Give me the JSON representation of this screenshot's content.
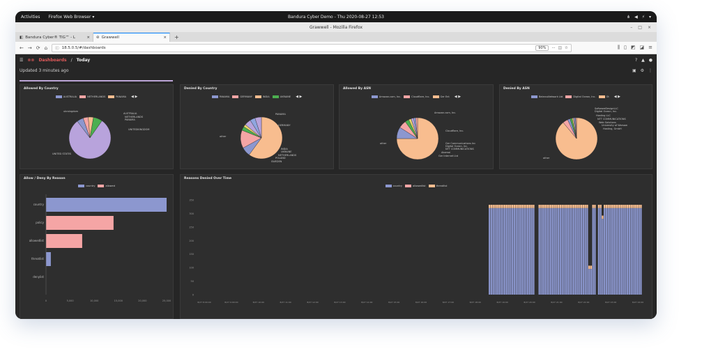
{
  "os_bar": {
    "activities": "Activities",
    "app_menu": "Firefox Web Browser ▾",
    "clock": "Bandura Cyber Demo - Thu 2020-08-27 12:53",
    "tray": [
      "⋔",
      "◀",
      "⚡",
      "▾"
    ]
  },
  "browser": {
    "window_title": "Grawwell - Mozilla Firefox",
    "tabs": [
      {
        "label": "Bandura Cyber® TIG™ - L",
        "close": "×"
      },
      {
        "label": "Grawwell",
        "close": "×"
      }
    ],
    "new_tab": "+",
    "url": "18.5.0.5/#/dashboards",
    "zoom": "90%",
    "nav_icons": {
      "back": "←",
      "forward": "→",
      "reload": "⟳",
      "home": "⌂"
    }
  },
  "grafana": {
    "breadcrumb_folder": "Dashboards",
    "breadcrumb_sep": "/",
    "breadcrumb_page": "Today",
    "updated": "Updated 3 minutes ago"
  },
  "colors": {
    "blue": "#8c97cf",
    "pink": "#f5a5a5",
    "peach": "#f8bd8f",
    "green": "#4caf50",
    "purple": "#b8a3dc",
    "bar_blue": "#8893c9"
  },
  "panels": {
    "allowed_country": {
      "title": "Allowed By Country",
      "legend": [
        "AUSTRALIA",
        "NETHERLANDS",
        "PANAMA"
      ],
      "labels": [
        "ukraingdom",
        "AUSTRALIA",
        "NETHERLANDS",
        "PANAMA",
        "UNITEDKINGDOM",
        "UNITED STATES"
      ]
    },
    "denied_country": {
      "title": "Denied By Country",
      "legend": [
        "PANAMA",
        "GERMANY",
        "INDIA",
        "UKRAINE"
      ],
      "labels": [
        "PANAMA",
        "GERMANY",
        "other",
        "INDIA",
        "UKRAINE",
        "NETHERLANDS",
        "POLAND",
        "SWEDEN"
      ]
    },
    "allowed_asn": {
      "title": "Allowed By ASN",
      "legend": [
        "Amazon.com, Inc.",
        "Cloudflare, Inc.",
        "Ger Ent"
      ],
      "labels": [
        "Amazon.com, Inc.",
        "Cloudflare, Inc.",
        "other",
        "Ger Communications Inc",
        "Digital Ocean, Inc.",
        "NTT COMMUNICATIONS",
        "Akamai",
        "Ger Internet Ltd"
      ]
    },
    "denied_asn": {
      "title": "Denied By ASN",
      "legend": [
        "BelarusNetwork Ltd",
        "Digital Ocean, Inc.",
        "Ot"
      ],
      "labels": [
        "SoftwareDesignLLC",
        "Digital Ocean, Inc.",
        "Hosting LLC",
        "NTT COMMUNICATIONS",
        "Web Solutions",
        "University of Warsaw",
        "Hosting, GmbH",
        "other"
      ]
    },
    "allow_deny_reason": {
      "title": "Allow / Deny By Reason",
      "legend": [
        "country",
        "allowed"
      ],
      "categories": [
        "country",
        "policy",
        "allowedlist",
        "threatlist",
        "denylist"
      ],
      "ticks": [
        "0",
        "5,000",
        "10,000",
        "15,000",
        "20,000",
        "25,000"
      ]
    },
    "reasons_time": {
      "title": "Reasons Denied Over Time",
      "legend": [
        "country",
        "allowedlist",
        "threatlist"
      ],
      "y_ticks": [
        "350",
        "300",
        "250",
        "200",
        "150",
        "100",
        "50",
        "0"
      ],
      "x_ticks": [
        "8/27 8:00:00",
        "8/27 9:00:00",
        "8/27 10:00",
        "8/27 11:00",
        "8/27 12:00",
        "8/27 13:00",
        "8/27 14:00",
        "8/27 15:00",
        "8/27 16:00",
        "8/27 17:00",
        "8/27 18:00",
        "8/27 19:00",
        "8/27 20:00",
        "8/27 21:00",
        "8/27 22:00",
        "8/27 23:00",
        "8/27 24:00"
      ]
    }
  },
  "chart_data": [
    {
      "type": "pie",
      "title": "Allowed By Country",
      "categories": [
        "UNITED STATES",
        "AUSTRALIA",
        "NETHERLANDS",
        "PANAMA",
        "UNITEDKINGDOM"
      ],
      "values": [
        80,
        5,
        4,
        4,
        7
      ]
    },
    {
      "type": "pie",
      "title": "Denied By Country",
      "categories": [
        "other",
        "PANAMA",
        "GERMANY",
        "INDIA",
        "UKRAINE",
        "NETHERLANDS",
        "POLAND",
        "SWEDEN"
      ],
      "values": [
        60,
        7,
        14,
        3,
        2,
        5,
        4,
        5
      ]
    },
    {
      "type": "pie",
      "title": "Allowed By ASN",
      "categories": [
        "other",
        "Amazon.com, Inc.",
        "Cloudflare, Inc.",
        "Ger Communications Inc",
        "Digital Ocean, Inc.",
        "NTT COMMUNICATIONS",
        "Akamai",
        "Ger Internet Ltd"
      ],
      "values": [
        75,
        9,
        6,
        3,
        2,
        2,
        1.5,
        1.5
      ]
    },
    {
      "type": "pie",
      "title": "Denied By ASN",
      "categories": [
        "other",
        "SoftwareDesignLLC",
        "Digital Ocean, Inc.",
        "Hosting LLC",
        "NTT COMMUNICATIONS",
        "Web Solutions",
        "University of Warsaw",
        "Hosting, GmbH"
      ],
      "values": [
        89,
        4,
        2,
        1.5,
        1,
        1,
        0.8,
        0.7
      ]
    },
    {
      "type": "bar",
      "title": "Allow / Deny By Reason",
      "categories": [
        "country",
        "policy",
        "allowedlist",
        "threatlist",
        "denylist"
      ],
      "values": [
        25000,
        14000,
        7500,
        1000,
        0
      ],
      "xlim": [
        0,
        25000
      ]
    },
    {
      "type": "bar",
      "title": "Reasons Denied Over Time",
      "series": [
        {
          "name": "country",
          "values": [
            320
          ]
        },
        {
          "name": "threatlist",
          "values": [
            12
          ]
        }
      ],
      "ylim": [
        0,
        350
      ]
    }
  ]
}
